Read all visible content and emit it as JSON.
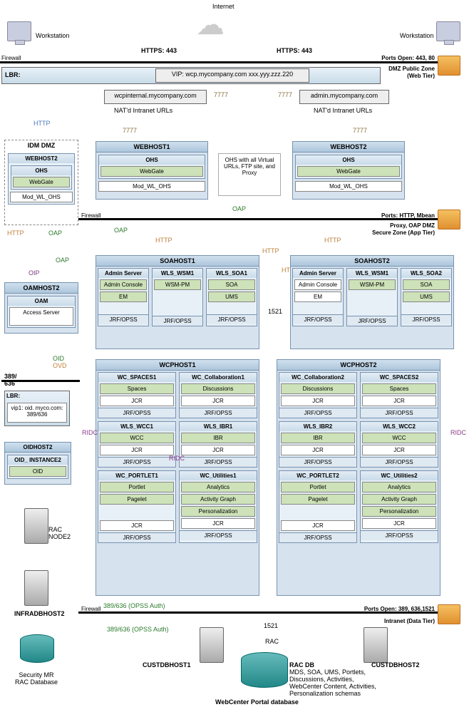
{
  "title": "Internet",
  "workstations": {
    "left": "Workstation",
    "right": "Workstation"
  },
  "https": {
    "left": "HTTPS: 443",
    "right": "HTTPS: 443"
  },
  "firewalls": {
    "f1": {
      "label": "Firewall",
      "ports": "Ports Open: 443, 80",
      "zone": "DMZ Public Zone",
      "zone2": "(Web Tier)"
    },
    "f2": {
      "label": "Firewall",
      "ports": "Ports: HTTP, Mbean",
      "zone": "Proxy, OAP DMZ",
      "zone2": "Secure Zone (App Tier)"
    },
    "f3": {
      "label": "Firewall",
      "ports": "Ports Open: 389, 636,1521",
      "zone": "Intranet (Data Tier)"
    }
  },
  "lbr": {
    "label": "LBR:",
    "vip": "VIP: wcp.mycompany.com    xxx.yyy.zzz.220"
  },
  "nat": {
    "left": "wcpinternal.mycompany.com",
    "right": "admin.mycompany.com",
    "lbl": "NAT'd Intranet URLs"
  },
  "port7777": "7777",
  "idm": {
    "title": "IDM DMZ",
    "webhost2": {
      "title": "WEBHOST2",
      "ohs": "OHS",
      "webgate": "WebGate",
      "mod": "Mod_WL_OHS"
    },
    "oamhost2": {
      "title": "OAMHOST2",
      "oam": "OAM",
      "access": "Access Server"
    },
    "lbr2": {
      "label": "LBR:",
      "vip": "vip1: oid. myco.com: 389/636"
    },
    "oidhost2": {
      "title": "OIDHOST2",
      "inst": "OID_ INSTANCE2",
      "oid": "OID"
    },
    "rac": "RAC NODE2",
    "infradb": "INFRADBHOST2",
    "secdb": "Security MR RAC Database"
  },
  "links": {
    "http": "HTTP",
    "oap": "OAP",
    "oip": "OIP",
    "oid": "OID",
    "ovd": "OVD",
    "ports": "389/ 636",
    "ridc": "RIDC"
  },
  "webhost": {
    "h1": {
      "title": "WEBHOST1",
      "ohs": "OHS",
      "webgate": "WebGate",
      "mod": "Mod_WL_OHS"
    },
    "h2": {
      "title": "WEBHOST2",
      "ohs": "OHS",
      "webgate": "WebGate",
      "mod": "Mod_WL_OHS"
    },
    "center": "OHS with all Virtual URLs, FTP site, and Proxy"
  },
  "soahost": {
    "h1": {
      "title": "SOAHOST1",
      "admin": {
        "title": "Admin Server",
        "console": "Admin Console",
        "em": "EM"
      },
      "wsm": {
        "title": "WLS_WSM1",
        "wsmpm": "WSM-PM"
      },
      "soa": {
        "title": "WLS_SOA1",
        "soa": "SOA",
        "ums": "UMS"
      }
    },
    "h2": {
      "title": "SOAHOST2",
      "admin": {
        "title": "Admin Server",
        "console": "Admin Console",
        "em": "EM"
      },
      "wsm": {
        "title": "WLS_WSM1",
        "wsmpm": "WSM-PM"
      },
      "soa": {
        "title": "WLS_SOA2",
        "soa": "SOA",
        "ums": "UMS"
      }
    }
  },
  "wcphost": {
    "h1": {
      "title": "WCPHOST1",
      "spaces": {
        "title": "WC_SPACES1",
        "spaces": "Spaces",
        "jcr": "JCR"
      },
      "collab": {
        "title": "WC_Collaboration1",
        "disc": "Discussions",
        "jcr": "JCR"
      },
      "wcc": {
        "title": "WLS_WCC1",
        "wcc": "WCC",
        "jcr": "JCR"
      },
      "ibr": {
        "title": "WLS_IBR1",
        "ibr": "IBR",
        "jcr": "JCR"
      },
      "portlet": {
        "title": "WC_PORTLET1",
        "portlet": "Portlet",
        "pagelet": "Pagelet",
        "jcr": "JCR"
      },
      "util": {
        "title": "WC_Utilities1",
        "analytics": "Analytics",
        "graph": "Activity Graph",
        "pers": "Personalization",
        "jcr": "JCR"
      }
    },
    "h2": {
      "title": "WCPHOST2",
      "collab": {
        "title": "WC_Collaboration2",
        "disc": "Discussions",
        "jcr": "JCR"
      },
      "spaces": {
        "title": "WC_SPACES2",
        "spaces": "Spaces",
        "jcr": "JCR"
      },
      "ibr": {
        "title": "WLS_IBR2",
        "ibr": "IBR",
        "jcr": "JCR"
      },
      "wcc": {
        "title": "WLS_WCC2",
        "wcc": "WCC",
        "jcr": "JCR"
      },
      "portlet": {
        "title": "WC_PORTLET2",
        "portlet": "Portlet",
        "pagelet": "Pagelet",
        "jcr": "JCR"
      },
      "util": {
        "title": "WC_Utilities2",
        "analytics": "Analytics",
        "graph": "Activity Graph",
        "pers": "Personalization",
        "jcr": "JCR"
      }
    }
  },
  "jrf": "JRF/OPSS",
  "db": {
    "port1521": "1521",
    "rac": "RAC",
    "h1": "CUSTDBHOST1",
    "h2": "CUSTDBHOST2",
    "racdb": "RAC DB",
    "schemas": "MDS, SOA, UMS, Portlets, Discussions, Activities, WebCenter Content, Activities, Personalization schemas",
    "portal": "WebCenter Portal database"
  },
  "opss": "389/636 (OPSS Auth)"
}
